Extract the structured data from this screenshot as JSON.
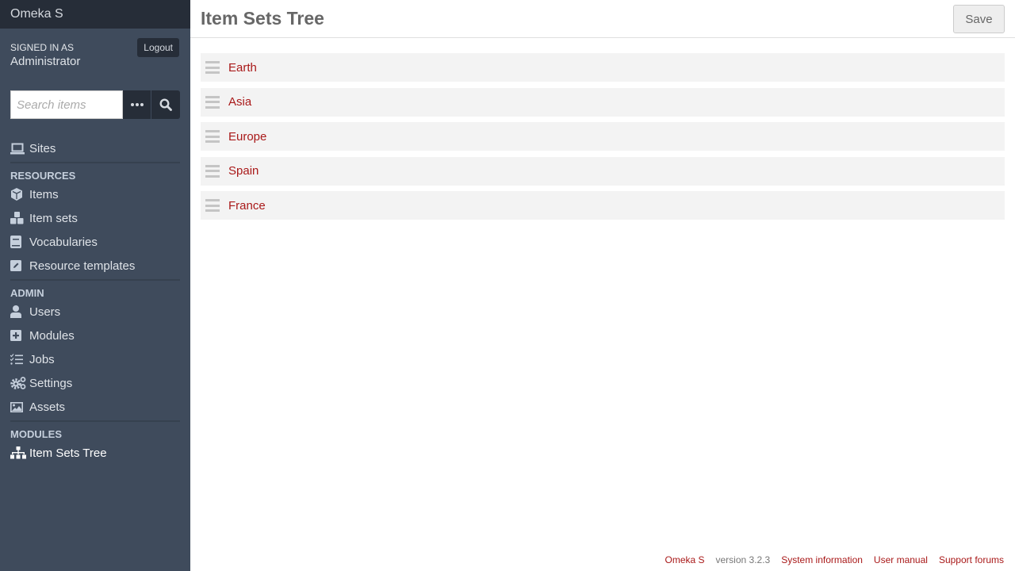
{
  "app": {
    "brand": "Omeka S"
  },
  "user": {
    "signed_in_label": "Signed in as",
    "name": "Administrator",
    "logout_label": "Logout"
  },
  "search": {
    "placeholder": "Search items",
    "options_icon": "ellipsis-icon",
    "submit_icon": "search-icon"
  },
  "nav": {
    "sites": {
      "label": "Sites",
      "icon": "laptop-icon"
    },
    "resources_heading": "Resources",
    "resources": [
      {
        "label": "Items",
        "icon": "cube-icon"
      },
      {
        "label": "Item sets",
        "icon": "cubes-icon"
      },
      {
        "label": "Vocabularies",
        "icon": "book-icon"
      },
      {
        "label": "Resource templates",
        "icon": "pencil-square-icon"
      }
    ],
    "admin_heading": "Admin",
    "admin": [
      {
        "label": "Users",
        "icon": "user-icon"
      },
      {
        "label": "Modules",
        "icon": "plus-square-icon"
      },
      {
        "label": "Jobs",
        "icon": "tasks-icon"
      },
      {
        "label": "Settings",
        "icon": "cogs-icon"
      },
      {
        "label": "Assets",
        "icon": "image-icon"
      }
    ],
    "modules_heading": "Modules",
    "modules": [
      {
        "label": "Item Sets Tree",
        "icon": "sitemap-icon",
        "active": true
      }
    ]
  },
  "page": {
    "title": "Item Sets Tree",
    "save_label": "Save"
  },
  "tree": {
    "items": [
      {
        "label": "Earth"
      },
      {
        "label": "Asia"
      },
      {
        "label": "Europe"
      },
      {
        "label": "Spain"
      },
      {
        "label": "France"
      }
    ]
  },
  "footer": {
    "omeka_link": "Omeka S",
    "version": "version 3.2.3",
    "system_info": "System information",
    "user_manual": "User manual",
    "support_forums": "Support forums"
  },
  "colors": {
    "sidebar": "#3f4b5c",
    "sidebar_dark": "#262d38",
    "link": "#a91919"
  }
}
